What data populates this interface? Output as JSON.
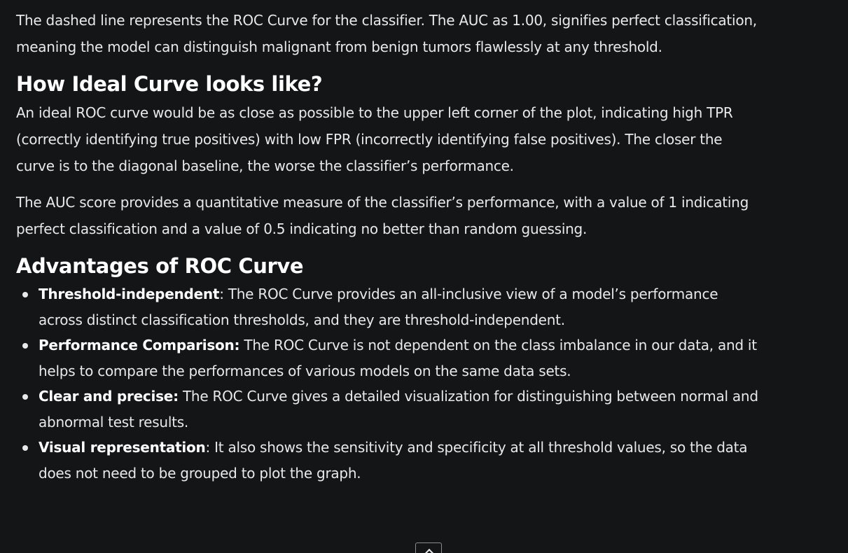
{
  "intro_paragraph": "The dashed line represents the ROC Curve for the classifier. The AUC as 1.00, signifies perfect classification, meaning the model can distinguish malignant from benign tumors flawlessly at any threshold.",
  "section_ideal": {
    "heading": "How Ideal Curve looks like?",
    "paragraph1": "An ideal ROC curve would be as close as possible to the upper left corner of the plot, indicating high TPR (correctly identifying true positives) with low FPR (incorrectly identifying false positives). The closer the curve is to the diagonal baseline, the worse the classifier’s performance.",
    "paragraph2": "The AUC score provides a quantitative measure of the classifier’s performance, with a value of 1 indicating perfect classification and a value of 0.5 indicating no better than random guessing."
  },
  "section_advantages": {
    "heading": "Advantages of ROC Curve",
    "items": [
      {
        "term": "Threshold-independent",
        "text": ": The ROC Curve provides an all-inclusive view of a model’s performance across distinct classification thresholds, and they are threshold-independent."
      },
      {
        "term": "Performance Comparison:",
        "text": " The ROC Curve is not dependent on the class imbalance in our data, and it helps to compare the performances of various models on the same data sets."
      },
      {
        "term": "Clear and precise:",
        "text": " The ROC Curve gives a detailed visualization for distinguishing between normal and abnormal test results."
      },
      {
        "term": "Visual representation",
        "text": ": It also shows the sensitivity and specificity at all threshold values, so the data does not need to be grouped to plot the graph."
      }
    ]
  },
  "scroll_button": {
    "icon": "chevron-up-icon"
  },
  "colors": {
    "background": "#141517",
    "text": "#e8e9eb",
    "heading": "#ffffff"
  }
}
